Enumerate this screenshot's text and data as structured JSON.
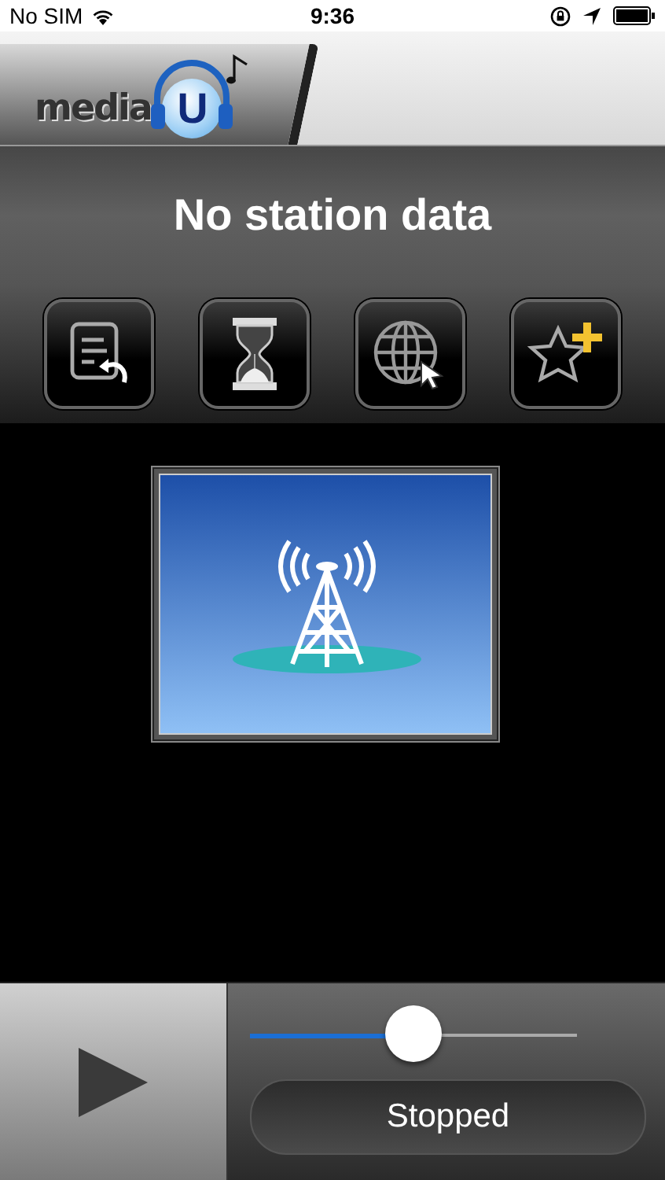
{
  "status_bar": {
    "carrier": "No SIM",
    "time": "9:36"
  },
  "logo": {
    "text": "media",
    "badge": "U"
  },
  "station": {
    "title": "No station data"
  },
  "toolbar": [
    {
      "kind": "history"
    },
    {
      "kind": "timer"
    },
    {
      "kind": "web"
    },
    {
      "kind": "favorite"
    }
  ],
  "player": {
    "state": "Stopped",
    "volume": {
      "level": 0.5
    }
  }
}
